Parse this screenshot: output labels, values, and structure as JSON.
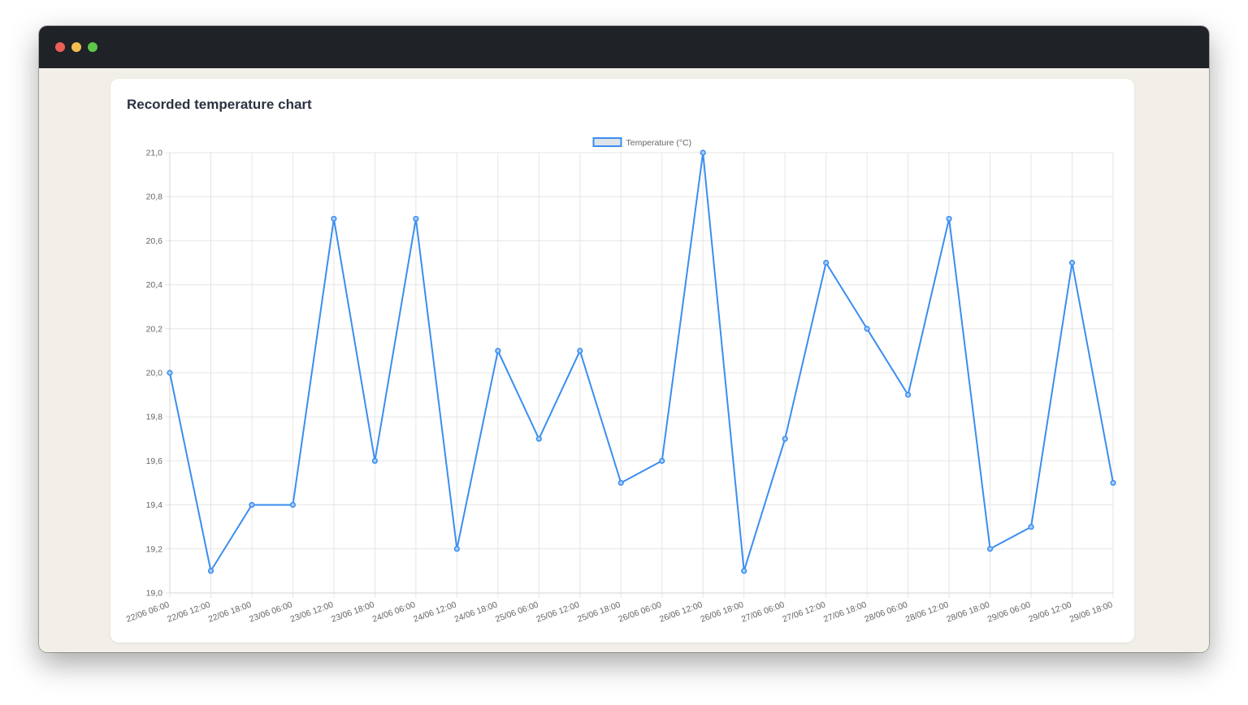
{
  "window": {
    "controls": [
      {
        "name": "close",
        "color": "#ec5f57"
      },
      {
        "name": "minimize",
        "color": "#f4bd4f"
      },
      {
        "name": "zoom",
        "color": "#5dc74a"
      }
    ]
  },
  "card": {
    "title": "Recorded temperature chart"
  },
  "colors": {
    "line": "#3a8ef0",
    "legend_fill": "#dfe3ea",
    "grid": "#e6e6e6",
    "axis_text": "#666666"
  },
  "chart_data": {
    "type": "line",
    "title": "",
    "xlabel": "",
    "ylabel": "",
    "legend": {
      "position": "top-center"
    },
    "grid": true,
    "ylim": [
      19.0,
      21.0
    ],
    "y_ticks": [
      "19,0",
      "19,2",
      "19,4",
      "19,6",
      "19,8",
      "20,0",
      "20,2",
      "20,4",
      "20,6",
      "20,8",
      "21,0"
    ],
    "categories": [
      "22/06 06:00",
      "22/06 12:00",
      "22/06 18:00",
      "23/06 06:00",
      "23/06 12:00",
      "23/06 18:00",
      "24/06 06:00",
      "24/06 12:00",
      "24/06 18:00",
      "25/06 06:00",
      "25/06 12:00",
      "25/06 18:00",
      "26/06 06:00",
      "26/06 12:00",
      "26/06 18:00",
      "27/06 06:00",
      "27/06 12:00",
      "27/06 18:00",
      "28/06 06:00",
      "28/06 12:00",
      "28/06 18:00",
      "29/06 06:00",
      "29/06 12:00",
      "29/06 18:00"
    ],
    "series": [
      {
        "name": "Temperature (°C)",
        "values": [
          20.0,
          19.1,
          19.4,
          19.4,
          20.7,
          19.6,
          20.7,
          19.2,
          20.1,
          19.7,
          20.1,
          19.5,
          19.6,
          21.0,
          19.1,
          19.7,
          20.5,
          20.2,
          19.9,
          20.7,
          19.2,
          19.3,
          20.5,
          19.5
        ]
      }
    ]
  }
}
